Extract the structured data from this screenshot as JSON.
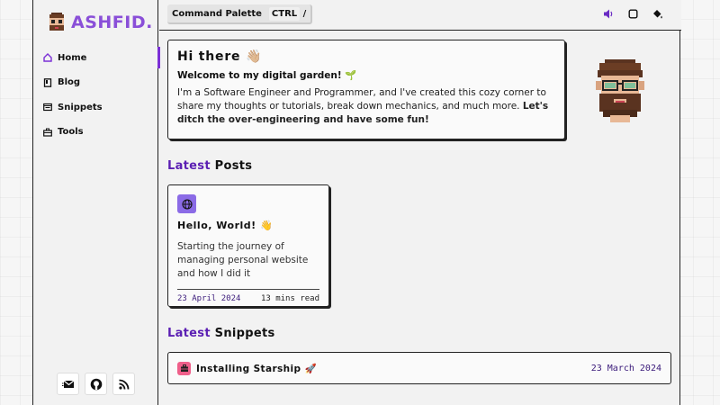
{
  "brand": {
    "name": "ASHFID."
  },
  "nav": {
    "items": [
      {
        "label": "Home",
        "icon": "home-icon",
        "active": true
      },
      {
        "label": "Blog",
        "icon": "book-icon",
        "active": false
      },
      {
        "label": "Snippets",
        "icon": "code-icon",
        "active": false
      },
      {
        "label": "Tools",
        "icon": "toolbox-icon",
        "active": false
      }
    ]
  },
  "social": [
    "mail-icon",
    "github-icon",
    "rss-icon"
  ],
  "topbar": {
    "command_label": "Command Palette",
    "shortcut_key": "CTRL",
    "shortcut_symbol": "/",
    "icons": [
      "volume-icon",
      "square-icon",
      "paint-bucket-icon"
    ]
  },
  "hero": {
    "greeting": "Hi there 👋🏼",
    "subtitle": "Welcome to my digital garden! 🌱",
    "body": "I'm a Software Engineer and Programmer, and I've created this cozy corner to share my thoughts or tutorials, break down mechanics, and much more.",
    "body_bold": "Let's ditch the over-engineering and have some fun!"
  },
  "posts_section": {
    "highlight": "Latest",
    "rest": "Posts"
  },
  "posts": [
    {
      "title": "Hello, World! 👋",
      "description": "Starting the journey of managing personal website and how I did it",
      "date": "23 April 2024",
      "read_time": "13 mins read",
      "icon": "globe-icon"
    }
  ],
  "snippets_section": {
    "highlight": "Latest",
    "rest": "Snippets"
  },
  "snippets": [
    {
      "title": "Installing Starship 🚀",
      "date": "23 March 2024",
      "icon": "toolbox-icon"
    }
  ],
  "colors": {
    "accent": "#7b2fd6",
    "brand": "#8a4fd8",
    "heading_highlight": "#5b1fb3",
    "post_icon_bg": "#8b6be6",
    "snippet_icon_bg": "#ef5f8a"
  }
}
